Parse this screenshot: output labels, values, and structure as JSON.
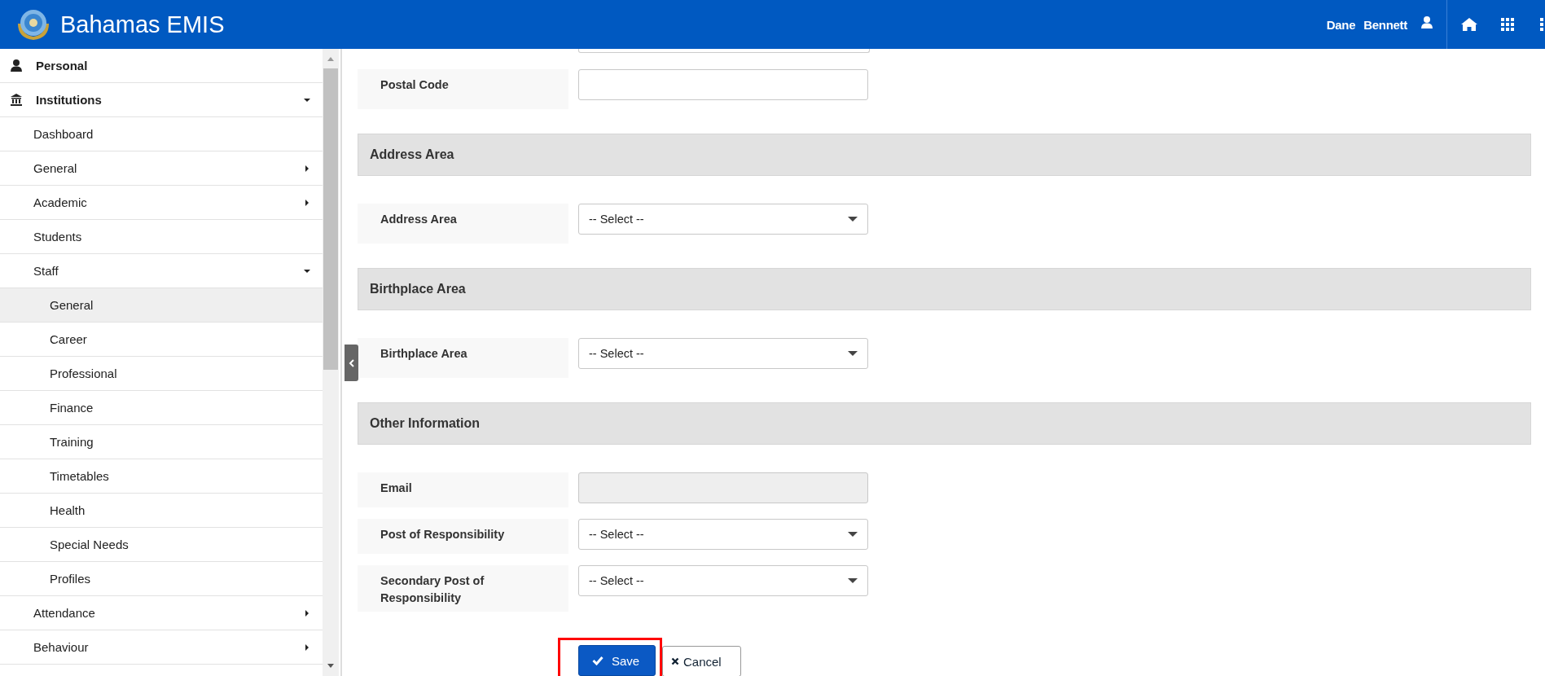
{
  "header": {
    "title": "Bahamas EMIS",
    "user_first": "Dane",
    "user_last": "Bennett"
  },
  "sidebar": {
    "items": [
      {
        "label": "Personal",
        "selected": false
      },
      {
        "label": "Institutions",
        "expanded": true,
        "selected": false,
        "children": [
          {
            "label": "Dashboard",
            "selected": false
          },
          {
            "label": "General",
            "expanded": false,
            "selected": false
          },
          {
            "label": "Academic",
            "expanded": false,
            "selected": false
          },
          {
            "label": "Students",
            "selected": false
          },
          {
            "label": "Staff",
            "expanded": true,
            "selected": false,
            "children": [
              {
                "label": "General",
                "selected": true
              },
              {
                "label": "Career",
                "selected": false
              },
              {
                "label": "Professional",
                "selected": false
              },
              {
                "label": "Finance",
                "selected": false
              },
              {
                "label": "Training",
                "selected": false
              },
              {
                "label": "Timetables",
                "selected": false
              },
              {
                "label": "Health",
                "selected": false
              },
              {
                "label": "Special Needs",
                "selected": false
              },
              {
                "label": "Profiles",
                "selected": false
              }
            ]
          },
          {
            "label": "Attendance",
            "expanded": false,
            "selected": false
          },
          {
            "label": "Behaviour",
            "expanded": false,
            "selected": false
          }
        ]
      }
    ]
  },
  "form": {
    "sections": [
      {
        "partial_field": true,
        "fields": [
          {
            "label": "Postal Code",
            "kind": "text",
            "disabled": false
          }
        ]
      },
      {
        "title": "Address Area",
        "fields": [
          {
            "label": "Address Area",
            "kind": "select",
            "value": "-- Select --",
            "disabled": false
          }
        ]
      },
      {
        "title": "Birthplace Area",
        "fields": [
          {
            "label": "Birthplace Area",
            "kind": "select",
            "value": "-- Select --",
            "disabled": false
          }
        ]
      },
      {
        "title": "Other Information",
        "fields": [
          {
            "label": "Email",
            "kind": "text",
            "disabled": true
          },
          {
            "label": "Post of Responsibility",
            "kind": "select",
            "value": "-- Select --",
            "disabled": false
          },
          {
            "label": "Secondary Post of Responsibility",
            "kind": "select",
            "value": "-- Select --",
            "disabled": false
          }
        ]
      }
    ]
  },
  "buttons": [
    {
      "label": "Save",
      "kind": "primary",
      "highlighted": true
    },
    {
      "label": "Cancel",
      "kind": "secondary",
      "highlighted": false
    }
  ]
}
